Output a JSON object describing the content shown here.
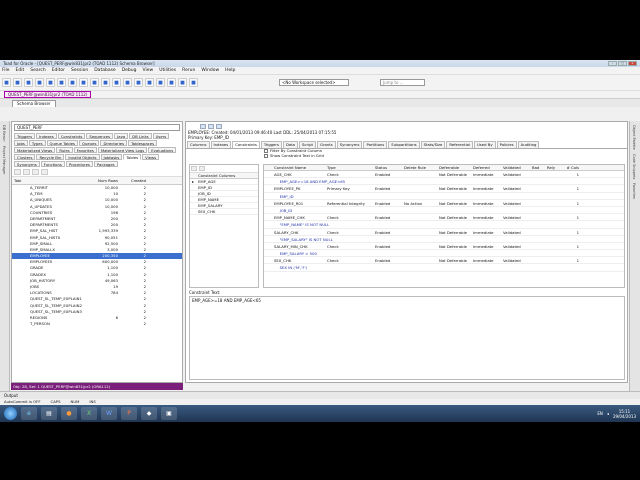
{
  "app": {
    "title": "Toad for Oracle - [QUEST_PERF@win831|pr2 (TOAD 1112) Schema Browser]"
  },
  "menu": [
    "File",
    "Edit",
    "Search",
    "Editor",
    "Session",
    "Database",
    "Debug",
    "View",
    "Utilities",
    "Rerun",
    "Window",
    "Help"
  ],
  "toolbar": {
    "workspace": "<No Workspace selected>",
    "jump_placeholder": "Jump to ..."
  },
  "connection": "QUEST_PERF@win831|pr2 (TOAD 1112)",
  "doc_tab": "Schema Browser",
  "left_strip": [
    "DB Rerun",
    "Project Manager"
  ],
  "right_strip": [
    "Object Palette",
    "Code Snippets",
    "Favorites"
  ],
  "schema": {
    "selected": "QUEST_PERF",
    "object_tabs": [
      "Triggers",
      "Indexes",
      "Constraints",
      "Sequences",
      "Java",
      "DB Links",
      "Users",
      "Jobs",
      "Types",
      "Queue Tables",
      "Queues",
      "Directories",
      "Tablespaces",
      "Materialized Views",
      "Rules",
      "Favorites",
      "Materialized View Logs",
      "Evaluations",
      "Clusters",
      "Recycle Bin",
      "Invalid Objects",
      "Jobtasks",
      "Tables",
      "Views",
      "Synonyms",
      "Functions",
      "Procedures",
      "Packages"
    ],
    "active_tab": "Tables",
    "columns": [
      "Tabl",
      "Num Rows",
      "Created"
    ],
    "rows": [
      {
        "name": "A_TERRIT",
        "num": "10,000",
        "created": "2"
      },
      {
        "name": "A_TEM",
        "num": "10",
        "created": "2"
      },
      {
        "name": "A_UNIQUES",
        "num": "10,000",
        "created": "2"
      },
      {
        "name": "A_UPDATES",
        "num": "10,000",
        "created": "2"
      },
      {
        "name": "COUNTRIES",
        "num": "196",
        "created": "2"
      },
      {
        "name": "DEPARTMENT",
        "num": "200",
        "created": "2"
      },
      {
        "name": "DEPARTMENTS",
        "num": "200",
        "created": "2"
      },
      {
        "name": "EMP_SAL_HIST",
        "num": "1,993,339",
        "created": "2"
      },
      {
        "name": "EMP_SAL_HISTX",
        "num": "90,051",
        "created": "2"
      },
      {
        "name": "EMP_SMALL",
        "num": "92,500",
        "created": "2"
      },
      {
        "name": "EMP_SMALLX",
        "num": "3,000",
        "created": "2"
      },
      {
        "name": "EMPLOYEE",
        "num": "200,350",
        "created": "2"
      },
      {
        "name": "EMPLOYEES",
        "num": "600,000",
        "created": "2"
      },
      {
        "name": "GRADE",
        "num": "1,100",
        "created": "2"
      },
      {
        "name": "GRADEX",
        "num": "1,100",
        "created": "2"
      },
      {
        "name": "JOB_HISTORY",
        "num": "49,063",
        "created": "2"
      },
      {
        "name": "JOBS",
        "num": "19",
        "created": "2"
      },
      {
        "name": "LOCATIONS",
        "num": "784",
        "created": "2"
      },
      {
        "name": "QUEST_SL_TEMP_EXPLAIN1",
        "num": "",
        "created": "2"
      },
      {
        "name": "QUEST_SL_TEMP_EXPLAIN2",
        "num": "",
        "created": "2"
      },
      {
        "name": "QUEST_SL_TEMP_EXPLAIN3",
        "num": "",
        "created": "2"
      },
      {
        "name": "REGIONS",
        "num": "6",
        "created": "2"
      },
      {
        "name": "T_PERSON",
        "num": "",
        "created": "2"
      }
    ],
    "selected_row": 11,
    "status": "Obj: 28, Sel: 1    QUEST_PERF@win831|pr2 (ORA112)"
  },
  "detail": {
    "line1": "EMPLOYEE:  Created: 04/01/2013 09:46:40    Last DDL: 25/04/2013 07:15:55",
    "line2": "Primary Key: EMP_ID",
    "tabs": [
      "Columns",
      "Indexes",
      "Constraints",
      "Triggers",
      "Data",
      "Script",
      "Grants",
      "Synonyms",
      "Partitions",
      "Subpartitions",
      "Stats/Size",
      "Referential",
      "Used By",
      "Policies",
      "Auditing"
    ],
    "active_tab": "Constraints",
    "constraint_columns": {
      "header": "Constraint Columns",
      "rows": [
        "EMP_AGE",
        "EMP_ID",
        "JOB_ID",
        "EMP_NAME",
        "EMP_SALARY",
        "SEX_CHK"
      ]
    },
    "filter_by_constraint": "Filter By Constraint Column",
    "show_constraint_text": "Show Constraint Text in Grid",
    "con_columns": [
      "Constraint Name",
      "Type",
      "Status",
      "Delete Rule",
      "Deferrable",
      "Deferred",
      "Validated",
      "Bad",
      "Rely",
      "# Cols"
    ],
    "con_rows": [
      {
        "sub": false,
        "name": "AGE_CHK",
        "type": "Check",
        "status": "Enabled",
        "del": "",
        "defr": "Not Deferrable",
        "defd": "Immediate",
        "val": "Validated",
        "cols": "1"
      },
      {
        "sub": true,
        "name": "EMP_AGE>=18 AND EMP_AGE<65",
        "type": "",
        "status": "",
        "del": "",
        "defr": "",
        "defd": "",
        "val": "",
        "cols": ""
      },
      {
        "sub": false,
        "name": "EMPLOYEE_PK",
        "type": "Primary Key",
        "status": "Enabled",
        "del": "",
        "defr": "Not Deferrable",
        "defd": "Immediate",
        "val": "Validated",
        "cols": "1"
      },
      {
        "sub": true,
        "name": "EMP_ID",
        "type": "",
        "status": "",
        "del": "",
        "defr": "",
        "defd": "",
        "val": "",
        "cols": ""
      },
      {
        "sub": false,
        "name": "EMPLOYEE_R01",
        "type": "Referential Integrity",
        "status": "Enabled",
        "del": "No Action",
        "defr": "Not Deferrable",
        "defd": "Immediate",
        "val": "Validated",
        "cols": "1"
      },
      {
        "sub": true,
        "name": "JOB_ID",
        "type": "",
        "status": "",
        "del": "",
        "defr": "",
        "defd": "",
        "val": "",
        "cols": ""
      },
      {
        "sub": false,
        "name": "EMP_NAME_CHK",
        "type": "Check",
        "status": "Enabled",
        "del": "",
        "defr": "Not Deferrable",
        "defd": "Immediate",
        "val": "Validated",
        "cols": "1"
      },
      {
        "sub": true,
        "name": "\"EMP_NAME\" IS NOT NULL",
        "type": "",
        "status": "",
        "del": "",
        "defr": "",
        "defd": "",
        "val": "",
        "cols": ""
      },
      {
        "sub": false,
        "name": "SALARY_CHK",
        "type": "Check",
        "status": "Enabled",
        "del": "",
        "defr": "Not Deferrable",
        "defd": "Immediate",
        "val": "Validated",
        "cols": "1"
      },
      {
        "sub": true,
        "name": "\"EMP_SALARY\" IS NOT NULL",
        "type": "",
        "status": "",
        "del": "",
        "defr": "",
        "defd": "",
        "val": "",
        "cols": ""
      },
      {
        "sub": false,
        "name": "SALARY_MIN_CHK",
        "type": "Check",
        "status": "Enabled",
        "del": "",
        "defr": "Not Deferrable",
        "defd": "Immediate",
        "val": "Validated",
        "cols": "1"
      },
      {
        "sub": true,
        "name": "EMP_SALARY > 500",
        "type": "",
        "status": "",
        "del": "",
        "defr": "",
        "defd": "",
        "val": "",
        "cols": ""
      },
      {
        "sub": false,
        "name": "SEX_CHK",
        "type": "Check",
        "status": "Enabled",
        "del": "",
        "defr": "Not Deferrable",
        "defd": "Immediate",
        "val": "Validated",
        "cols": "1"
      },
      {
        "sub": true,
        "name": "SEX IN ('M','F')",
        "type": "",
        "status": "",
        "del": "",
        "defr": "",
        "defd": "",
        "val": "",
        "cols": ""
      }
    ],
    "constraint_text_label": "Constraint Text:",
    "constraint_text": "EMP_AGE>=18 AND EMP_AGE<65"
  },
  "output_tab": "Output",
  "status_bar": [
    "AutoCommit is OFF",
    "CAPS",
    "NUM",
    "INS"
  ],
  "taskbar": {
    "clock_time": "15:11",
    "clock_date": "29/04/2013",
    "lang": "EN"
  },
  "colors": {
    "connection_accent": "#7a1f7a",
    "selection": "#3a6fd0"
  }
}
